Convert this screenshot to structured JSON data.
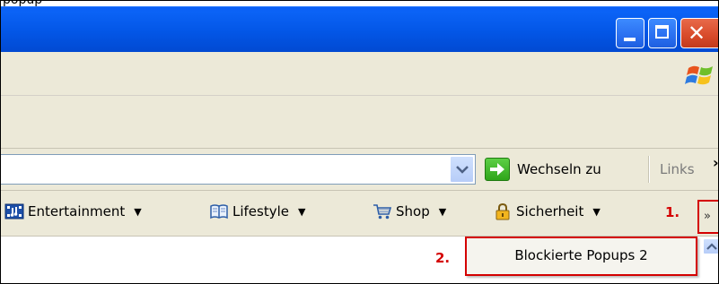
{
  "window": {
    "title_fragment": "popup",
    "minimize_icon": "minimize-icon",
    "maximize_icon": "maximize-icon",
    "close_icon": "close-icon"
  },
  "address_bar": {
    "go_label": "Wechseln zu",
    "links_label": "Links",
    "links_chevron": "›"
  },
  "links_bar": {
    "items": [
      {
        "label": "Entertainment",
        "icon": "film-icon"
      },
      {
        "label": "Lifestyle",
        "icon": "book-icon"
      },
      {
        "label": "Shop",
        "icon": "cart-icon"
      },
      {
        "label": "Sicherheit",
        "icon": "lock-icon"
      }
    ],
    "overflow_label": "»"
  },
  "annotations": {
    "step1": "1.",
    "step2": "2."
  },
  "overflow_menu": {
    "items": [
      {
        "label": "Blockierte Popups 2"
      }
    ]
  },
  "colors": {
    "titlebar": "#0356e6",
    "chrome": "#ece9d8",
    "highlight": "#d40000"
  }
}
